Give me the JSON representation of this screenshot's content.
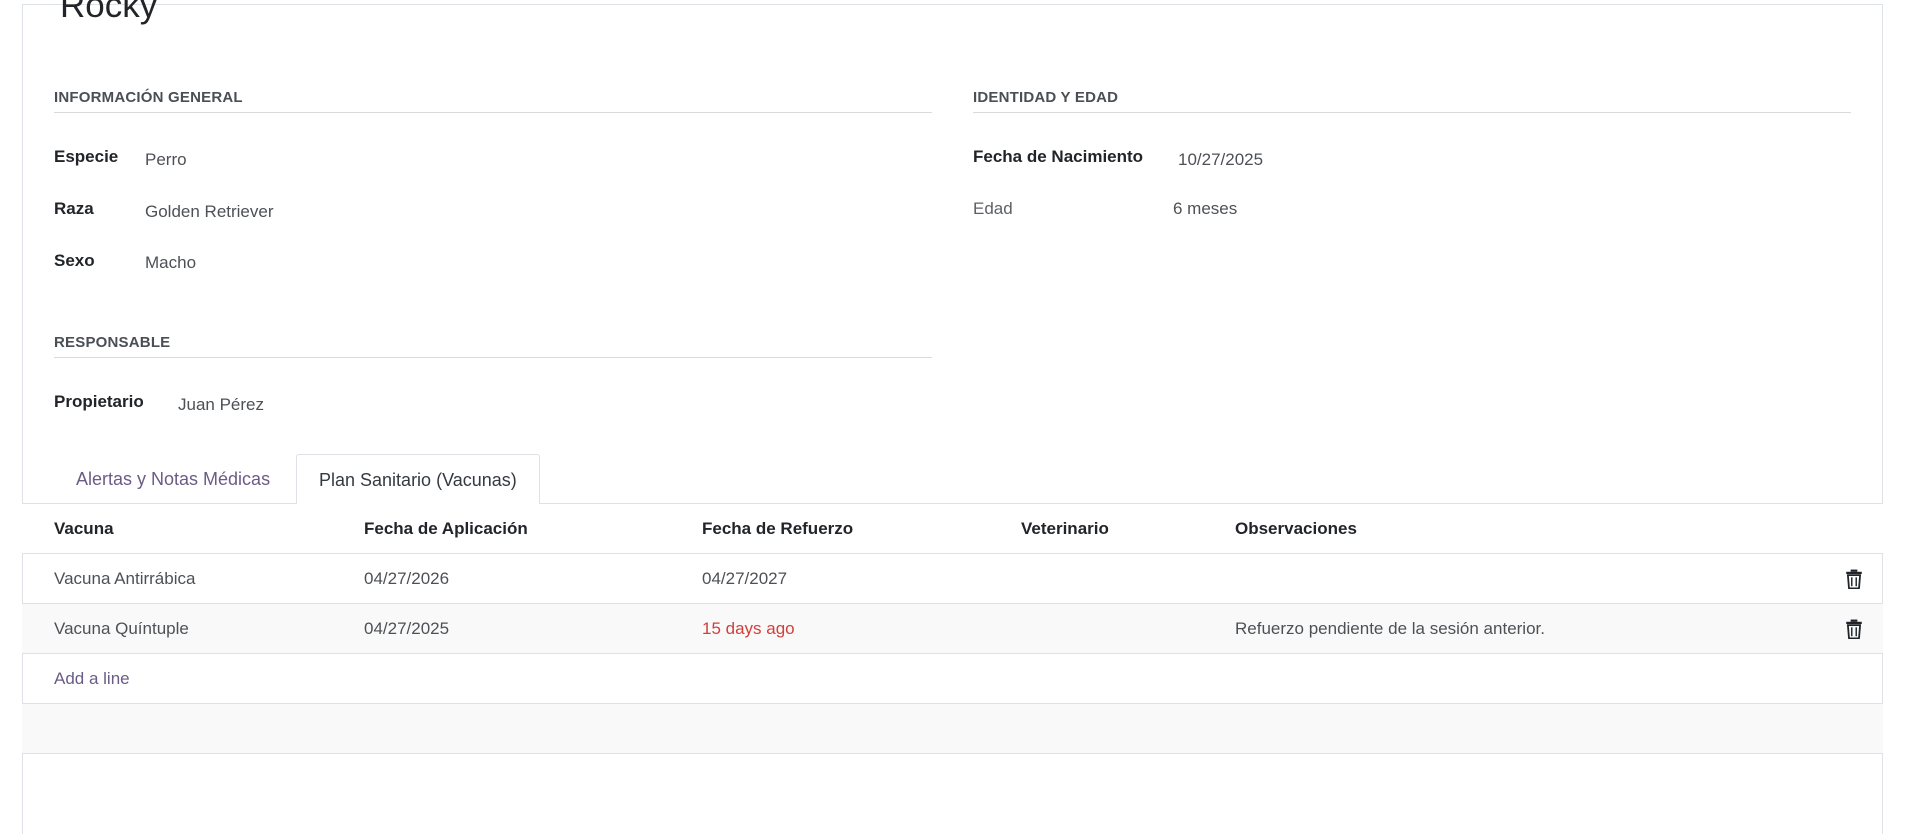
{
  "record": {
    "name": "Rocky"
  },
  "general": {
    "title": "INFORMACIÓN GENERAL",
    "fields": [
      {
        "label": "Especie",
        "value": "Perro"
      },
      {
        "label": "Raza",
        "value": "Golden Retriever"
      },
      {
        "label": "Sexo",
        "value": "Macho"
      }
    ]
  },
  "identity": {
    "title": "IDENTIDAD Y EDAD",
    "birth_label": "Fecha de Nacimiento",
    "birth_value": "10/27/2025",
    "age_label": "Edad",
    "age_value": "6 meses"
  },
  "owner": {
    "title": "RESPONSABLE",
    "label": "Propietario",
    "value": "Juan Pérez"
  },
  "tabs": [
    {
      "label": "Alertas y Notas Médicas",
      "active": false
    },
    {
      "label": "Plan Sanitario (Vacunas)",
      "active": true
    }
  ],
  "table": {
    "columns": [
      "Vacuna",
      "Fecha de Aplicación",
      "Fecha de Refuerzo",
      "Veterinario",
      "Observaciones"
    ],
    "rows": [
      {
        "vaccine": "Vacuna Antirrábica",
        "applied": "04/27/2026",
        "booster": "04/27/2027",
        "vet": "",
        "notes": ""
      },
      {
        "vaccine": "Vacuna Quíntuple",
        "applied": "04/27/2025",
        "booster": "15 days ago",
        "vet": "",
        "notes": "Refuerzo pendiente de la sesión anterior."
      }
    ],
    "add_line": "Add a line"
  },
  "colors": {
    "accent": "#6a5c86",
    "overdue": "#d23f3a",
    "border": "#dee2e6"
  },
  "icons": {
    "row_delete": "trash-icon"
  }
}
